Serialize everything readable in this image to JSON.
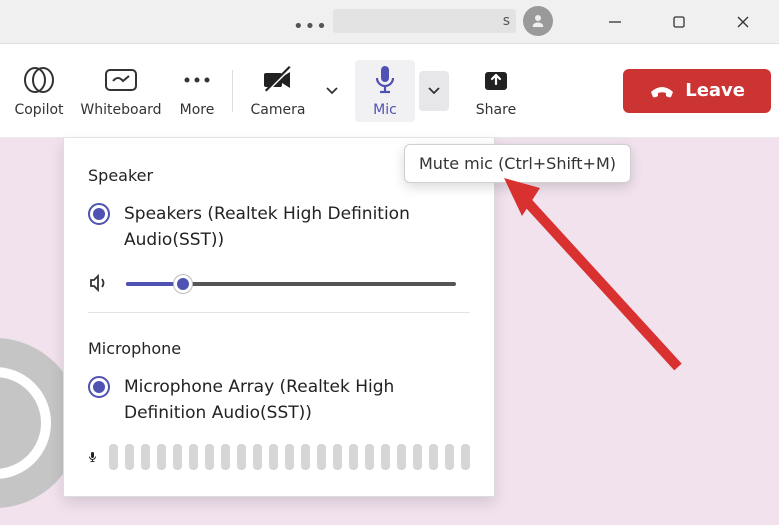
{
  "titlebar": {
    "caption_suffix": "s"
  },
  "toolbar": {
    "copilot": "Copilot",
    "whiteboard": "Whiteboard",
    "more": "More",
    "camera": "Camera",
    "mic": "Mic",
    "share": "Share",
    "leave": "Leave"
  },
  "tooltip": {
    "mute_mic": "Mute mic (Ctrl+Shift+M)"
  },
  "panel": {
    "speaker_heading": "Speaker",
    "speaker_device": "Speakers (Realtek High Definition Audio(SST))",
    "speaker_volume_pct": 17,
    "microphone_heading": "Microphone",
    "microphone_device": "Microphone Array (Realtek High Definition Audio(SST))"
  },
  "colors": {
    "accent": "#4f52b2",
    "leave_bg": "#cc3333"
  }
}
